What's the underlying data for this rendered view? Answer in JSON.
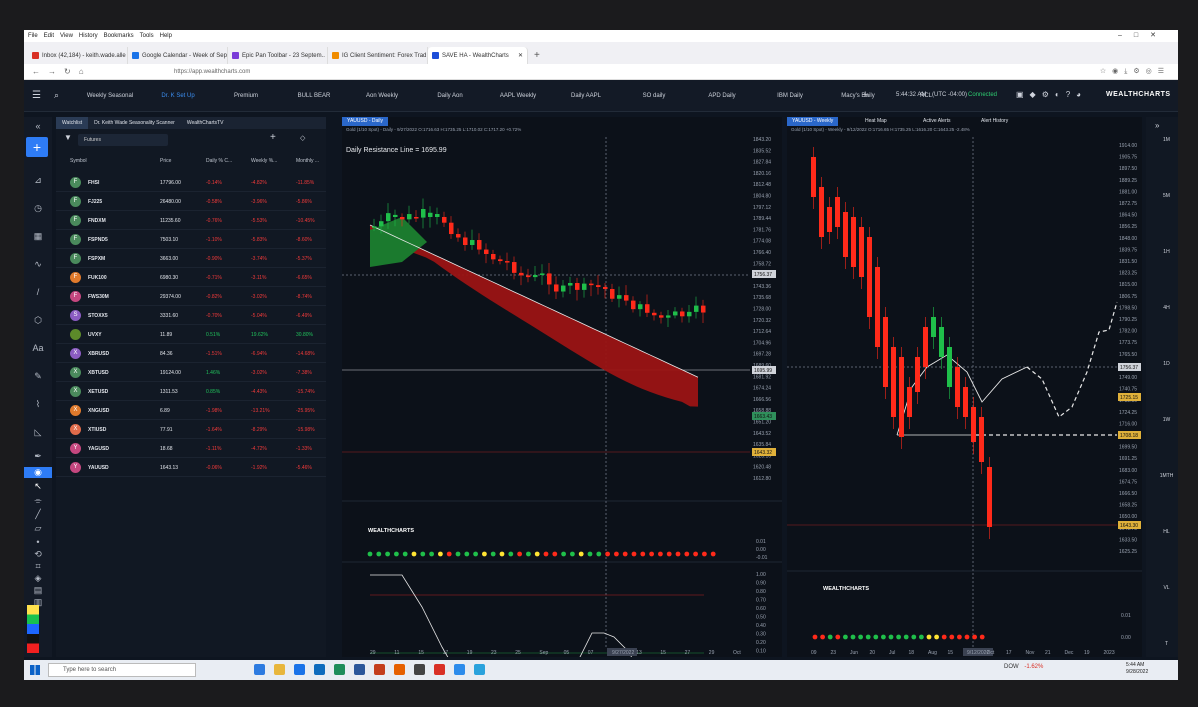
{
  "browser": {
    "menu": [
      "File",
      "Edit",
      "View",
      "History",
      "Bookmarks",
      "Tools",
      "Help"
    ],
    "tabs": [
      {
        "label": "Inbox (42,184) - keith.wade.alle",
        "color": "#d93025"
      },
      {
        "label": "Google Calendar - Week of Sept",
        "color": "#1a73e8"
      },
      {
        "label": "Epic Pan Toolbar - 23 Septem..",
        "color": "#7a3cd8"
      },
      {
        "label": "IG Client Sentiment: Forex Trad",
        "color": "#f08c00"
      },
      {
        "label": "SAVE HA - WealthCharts",
        "color": "#1d4ed8"
      }
    ],
    "url": "https://app.wealthcharts.com"
  },
  "app": {
    "layouts": [
      "Weekly Seasonal",
      "Dr. K Set Up",
      "Premium",
      "BULL BEAR",
      "Aon Weekly",
      "Daily Aon",
      "AAPL Weekly",
      "Daily AAPL",
      "SO daily",
      "APD Daily",
      "IBM Daily",
      "Macy's Daily",
      "RCL"
    ],
    "active_layout": "Dr. K Set Up",
    "time": "5:44:32 AM",
    "timezone": "(UTC -04:00)",
    "connection": "Connected",
    "logo": "WEALTHCHARTS"
  },
  "watchlist": {
    "tabs": [
      "Watchlist",
      "Dr. Keith Wade Seasonality Scanner",
      "WealthChartsTV"
    ],
    "select": "Futures",
    "headers": [
      "Symbol",
      "Price",
      "Daily % C...",
      "Weekly %...",
      "Monthly ..."
    ],
    "rows": [
      {
        "letter": "F",
        "color": "#4a8a5c",
        "symbol": "FHSI",
        "price": "17796.00",
        "daily": "-0.14%",
        "weekly": "-4.82%",
        "monthly": "-11.85%"
      },
      {
        "letter": "F",
        "color": "#4a8a5c",
        "symbol": "FJ225",
        "price": "26480.00",
        "daily": "-0.58%",
        "weekly": "-3.96%",
        "monthly": "-5.86%"
      },
      {
        "letter": "F",
        "color": "#4a8a5c",
        "symbol": "FNDXM",
        "price": "11235.60",
        "daily": "-0.76%",
        "weekly": "-5.53%",
        "monthly": "-10.45%"
      },
      {
        "letter": "F",
        "color": "#4a8a5c",
        "symbol": "FSPND5",
        "price": "7503.10",
        "daily": "-1.10%",
        "weekly": "-5.83%",
        "monthly": "-8.60%"
      },
      {
        "letter": "F",
        "color": "#4a8a5c",
        "symbol": "FSPXM",
        "price": "3663.00",
        "daily": "-0.90%",
        "weekly": "-3.74%",
        "monthly": "-5.37%"
      },
      {
        "letter": "F",
        "color": "#e07a2c",
        "symbol": "FUK100",
        "price": "6980.30",
        "daily": "-0.71%",
        "weekly": "-3.11%",
        "monthly": "-6.65%"
      },
      {
        "letter": "F",
        "color": "#c5477f",
        "symbol": "FWS30M",
        "price": "29374.00",
        "daily": "-0.82%",
        "weekly": "-3.02%",
        "monthly": "-8.74%"
      },
      {
        "letter": "S",
        "color": "#8b5cc2",
        "symbol": "STOXX5",
        "price": "3331.60",
        "daily": "-0.70%",
        "weekly": "-5.04%",
        "monthly": "-6.49%"
      },
      {
        "letter": "",
        "color": "#5c8a2a",
        "symbol": "UVXY",
        "price": "11.89",
        "daily": "0.51%",
        "weekly": "19.62%",
        "monthly": "30.80%",
        "up": true
      },
      {
        "letter": "X",
        "color": "#8b5cc2",
        "symbol": "XBRUSD",
        "price": "84.36",
        "daily": "-1.51%",
        "weekly": "-6.94%",
        "monthly": "-14.68%"
      },
      {
        "letter": "X",
        "color": "#4a8a5c",
        "symbol": "XBTUSD",
        "price": "19124.00",
        "daily": "1.46%",
        "weekly": "-3.02%",
        "monthly": "-7.38%",
        "dup": true
      },
      {
        "letter": "X",
        "color": "#4a8a5c",
        "symbol": "XETUSD",
        "price": "1311.53",
        "daily": "0.85%",
        "weekly": "-4.43%",
        "monthly": "-15.74%",
        "dup": true
      },
      {
        "letter": "X",
        "color": "#e07a2c",
        "symbol": "XNGUSD",
        "price": "6.89",
        "daily": "-1.98%",
        "weekly": "-13.21%",
        "monthly": "-25.95%"
      },
      {
        "letter": "X",
        "color": "#e06b4a",
        "symbol": "XTIUSD",
        "price": "77.91",
        "daily": "-1.64%",
        "weekly": "-8.29%",
        "monthly": "-15.98%"
      },
      {
        "letter": "Y",
        "color": "#c5477f",
        "symbol": "YAGUSD",
        "price": "18.68",
        "daily": "-1.11%",
        "weekly": "-4.72%",
        "monthly": "-1.33%"
      },
      {
        "letter": "Y",
        "color": "#c5477f",
        "symbol": "YAUUSD",
        "price": "1643.13",
        "daily": "-0.06%",
        "weekly": "-1.92%",
        "monthly": "-5.46%"
      }
    ]
  },
  "daily_chart": {
    "tab": "YAUUSD - Daily",
    "sub": "Gold (1/10 Spot) - Daily - 9/27/2022  O:1716.63  H:1735.25  L:1710.02  C:1717.20  +0.72%",
    "note": "Daily Resistance Line = 1695.99",
    "yticks": [
      "1843.20",
      "1835.52",
      "1827.84",
      "1820.16",
      "1812.48",
      "1804.80",
      "1797.12",
      "1789.44",
      "1781.76",
      "1774.08",
      "1766.40",
      "1758.72",
      "1751.04",
      "1743.36",
      "1735.68",
      "1728.00",
      "1720.32",
      "1712.64",
      "1704.96",
      "1697.28",
      "1689.60",
      "1681.92",
      "1674.24",
      "1666.56",
      "1658.88",
      "1651.20",
      "1643.52",
      "1635.84",
      "1628.16",
      "1620.48",
      "1612.80"
    ],
    "tags": [
      {
        "v": "1756.37",
        "c": "#d0d3da"
      },
      {
        "v": "1695.99",
        "c": "#d0d3da"
      },
      {
        "v": "1663.43",
        "c": "#2f8f5b"
      },
      {
        "v": "1643.32",
        "c": "#e0b13a"
      }
    ],
    "xticks": [
      "29",
      "11",
      "15",
      "17",
      "19",
      "23",
      "25",
      "Sep",
      "05",
      "07",
      "9/27/2022",
      "13",
      "15",
      "27",
      "29",
      "Oct"
    ],
    "sub_y": [
      "0.01",
      "0.00",
      "-0.01"
    ],
    "sub2_y": [
      "1.00",
      "0.90",
      "0.80",
      "0.70",
      "0.60",
      "0.50",
      "0.40",
      "0.30",
      "0.20",
      "0.10",
      "0.00"
    ]
  },
  "weekly_chart": {
    "tabs": [
      "YAUUSD - Weekly",
      "Heat Map",
      "Active Alerts",
      "Alert History"
    ],
    "sub": "Gold (1/10 Spot) - Weekly - 9/12/2022  O:1716.65  H:1735.25  L:1616.20  C:1643.25  -2.48%",
    "yticks": [
      "1914.00",
      "1905.75",
      "1897.50",
      "1889.25",
      "1881.00",
      "1872.75",
      "1864.50",
      "1856.25",
      "1848.00",
      "1839.75",
      "1831.50",
      "1823.25",
      "1815.00",
      "1806.75",
      "1798.50",
      "1790.25",
      "1782.00",
      "1773.75",
      "1765.50",
      "1757.25",
      "1749.00",
      "1740.75",
      "1732.50",
      "1724.25",
      "1716.00",
      "1707.75",
      "1699.50",
      "1691.25",
      "1683.00",
      "1674.75",
      "1666.50",
      "1658.25",
      "1650.00",
      "1641.75",
      "1633.50",
      "1625.25"
    ],
    "tags": [
      {
        "v": "1756.37",
        "c": "#d0d3da"
      },
      {
        "v": "1725.15",
        "c": "#e0b13a"
      },
      {
        "v": "1708.18",
        "c": "#e0b13a"
      },
      {
        "v": "1643.30",
        "c": "#e0b13a"
      }
    ],
    "xticks": [
      "09",
      "23",
      "Jun",
      "20",
      "Jul",
      "18",
      "Aug",
      "15",
      "9/12/2022",
      "Oct",
      "17",
      "Nov",
      "21",
      "Dec",
      "19",
      "2023"
    ],
    "sub_y": [
      "0.01",
      "0.00",
      "-0.01"
    ]
  },
  "right_rail": [
    "1M",
    "5M",
    "1H",
    "4H",
    "1D",
    "1W",
    "1MTH",
    "HL",
    "VL",
    "T"
  ],
  "taskbar": {
    "search": "Type here to search",
    "ticker": "DOW",
    "change": "-1.62%",
    "time": "5:44 AM",
    "date": "9/28/2022"
  }
}
